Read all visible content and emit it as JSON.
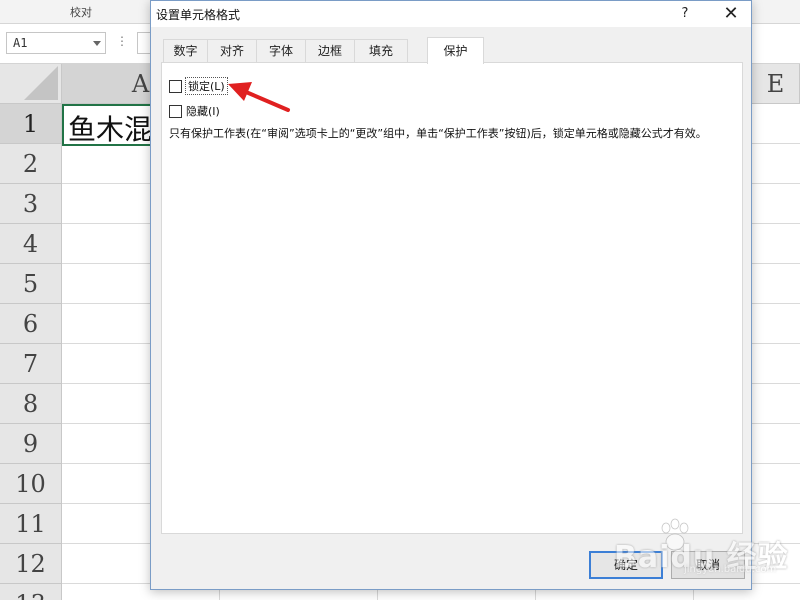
{
  "ribbon": {
    "group_label": "校对"
  },
  "formula_bar": {
    "name_box_value": "A1",
    "separator": "⋮"
  },
  "spreadsheet": {
    "column_headers": {
      "a": "A",
      "e": "E"
    },
    "row_headers": [
      "1",
      "2",
      "3",
      "4",
      "5",
      "6",
      "7",
      "8",
      "9",
      "10",
      "11",
      "12",
      "13"
    ],
    "cell_a1_text": "鱼木混",
    "selected_cell_color": "#217346"
  },
  "dialog": {
    "title": "设置单元格格式",
    "help_label": "?",
    "close_label": "✕",
    "tabs": [
      {
        "label": "数字"
      },
      {
        "label": "对齐"
      },
      {
        "label": "字体"
      },
      {
        "label": "边框"
      },
      {
        "label": "填充"
      },
      {
        "label": "保护"
      }
    ],
    "active_tab": "保护",
    "protection": {
      "locked_label": "锁定(L)",
      "locked_checked": false,
      "hidden_label": "隐藏(I)",
      "hidden_checked": false,
      "note": "只有保护工作表(在“审阅”选项卡上的“更改”组中，单击“保护工作表”按钮)后，锁定单元格或隐藏公式才有效。"
    },
    "ok_label": "确定",
    "cancel_label": "取消",
    "accent_color": "#3c7fd6"
  },
  "annotation": {
    "arrow_color": "#e02020"
  },
  "watermark": {
    "text": "Baidu 经验",
    "url": "jingyan.baidu.com"
  }
}
